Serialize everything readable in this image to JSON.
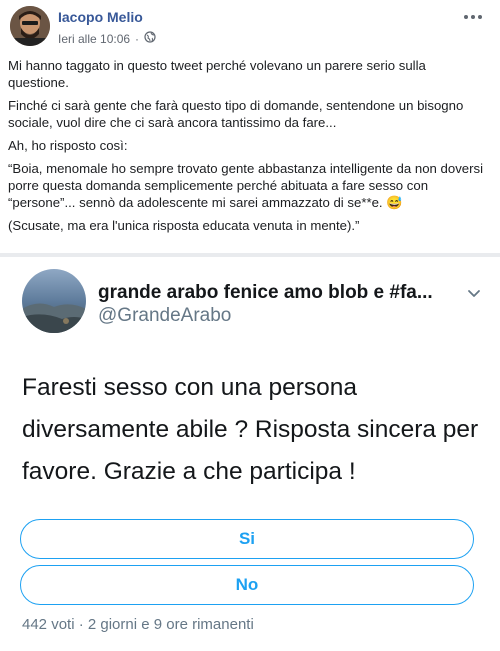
{
  "post": {
    "author": "Iacopo Melio",
    "timestamp": "Ieri alle 10:06",
    "privacy_icon": "globe-icon",
    "more_icon": "more-dots-icon",
    "paragraphs": [
      "Mi hanno taggato in questo tweet perché volevano un parere serio sulla questione.",
      "Finché ci sarà gente che farà questo tipo di domande, sentendone un bisogno sociale, vuol dire che ci sarà ancora tantissimo da fare...",
      "Ah, ho risposto così:",
      "“Boia, menomale ho sempre trovato gente abbastanza intelligente da non doversi porre questa domanda semplicemente perché abituata a fare sesso con “persone”... sennò da adolescente mi sarei ammazzato di se**e. 😅",
      "(Scusate, ma era l'unica risposta educata venuta in mente).”"
    ]
  },
  "tweet": {
    "name": "grande arabo fenice amo blob e #fa...",
    "handle": "@GrandeArabo",
    "text": "Faresti sesso con una persona diversamente abile ? Risposta sincera per favore. Grazie a che participa !",
    "poll": {
      "options": [
        "Si",
        "No"
      ],
      "meta": "442 voti · 2 giorni e 9 ore rimanenti"
    },
    "accent": "#1da1f2"
  }
}
